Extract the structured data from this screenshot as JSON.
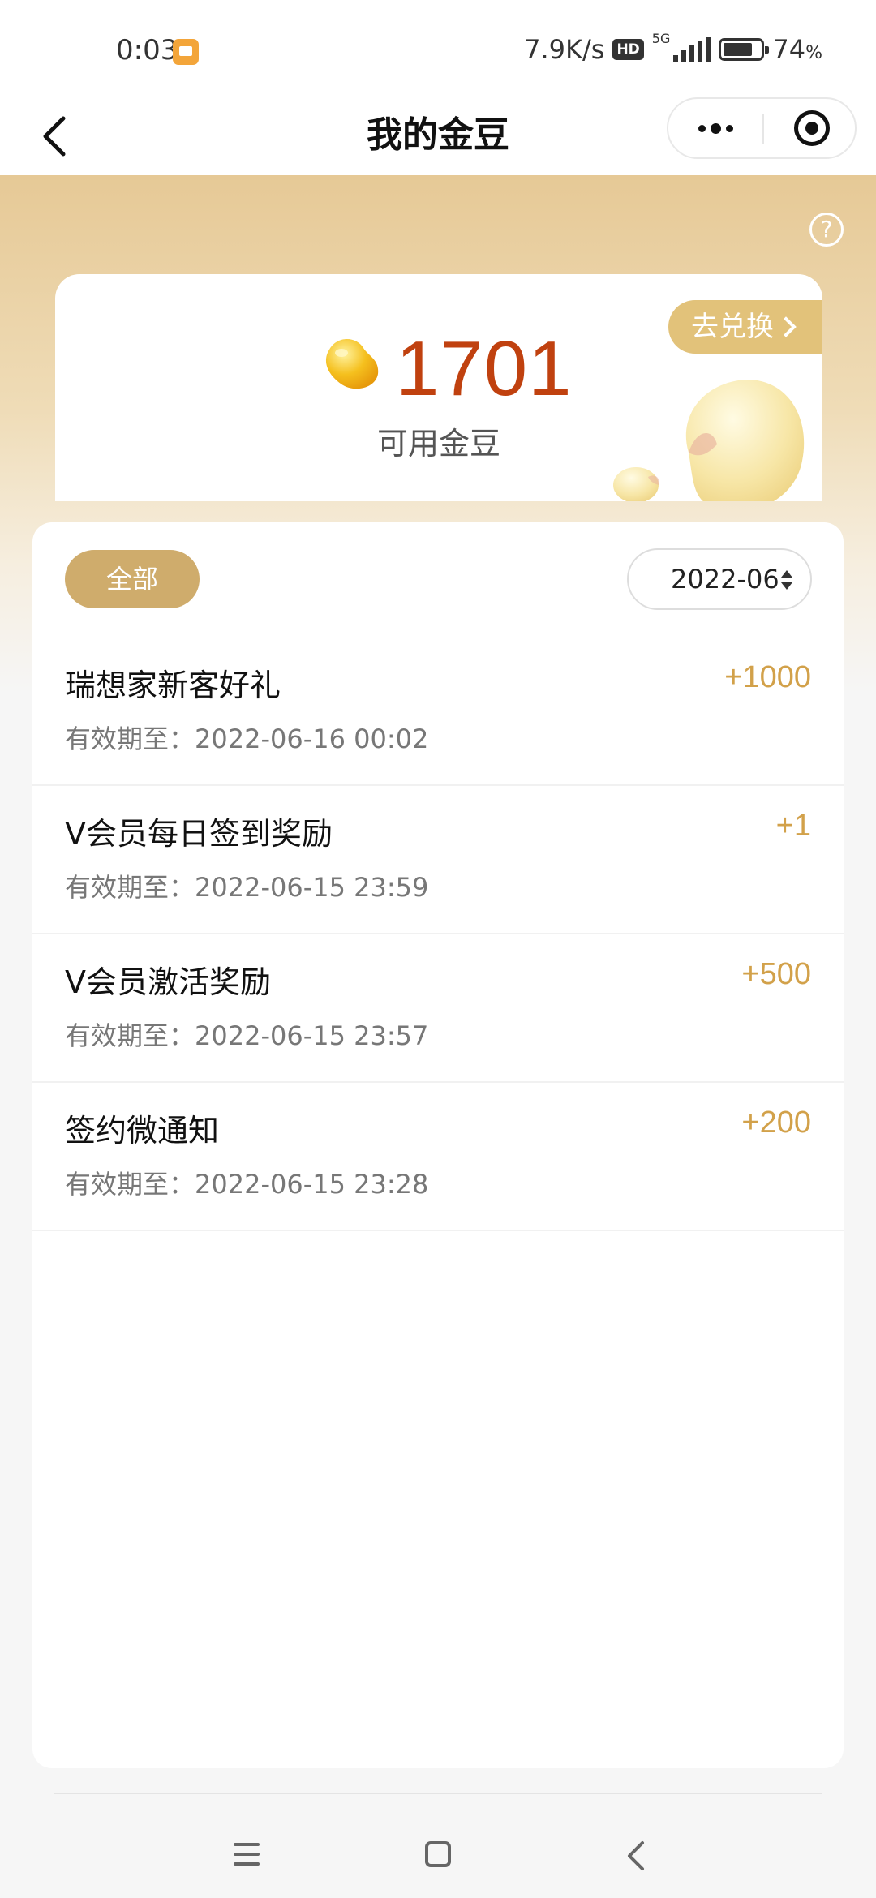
{
  "status_bar": {
    "time": "0:03",
    "net_speed": "7.9K/s",
    "hd_label": "HD",
    "network_label": "5G",
    "battery_pct": "74",
    "battery_unit": "%"
  },
  "navbar": {
    "title": "我的金豆"
  },
  "balance": {
    "value": "1701",
    "label": "可用金豆",
    "exchange_label": "去兑换"
  },
  "help_glyph": "?",
  "filter": {
    "all_label": "全部",
    "month_value": "2022-06"
  },
  "records": [
    {
      "title": "瑞想家新客好礼",
      "expiry": "有效期至：2022-06-16 00:02",
      "amount": "+1000"
    },
    {
      "title": "V会员每日签到奖励",
      "expiry": "有效期至：2022-06-15 23:59",
      "amount": "+1"
    },
    {
      "title": "V会员激活奖励",
      "expiry": "有效期至：2022-06-15 23:57",
      "amount": "+500"
    },
    {
      "title": "签约微通知",
      "expiry": "有效期至：2022-06-15 23:28",
      "amount": "+200"
    }
  ],
  "colors": {
    "accent_gold": "#cfac6c",
    "amount_gold": "#d2a14a",
    "balance_red": "#c0410f"
  }
}
